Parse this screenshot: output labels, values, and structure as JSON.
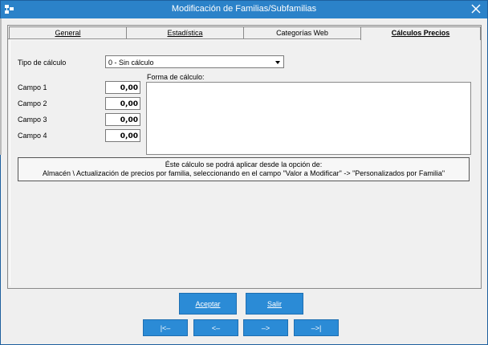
{
  "window": {
    "title": "Modificación de Familias/Subfamilias"
  },
  "tabs": [
    {
      "label": "General",
      "active": false
    },
    {
      "label": "Estadística",
      "active": false
    },
    {
      "label": "Categorías Web",
      "active": false
    },
    {
      "label": "Cálculos Precios",
      "active": true
    }
  ],
  "form": {
    "tipo_label": "Tipo de cálculo",
    "tipo_value": "0 - Sin cálculo",
    "campos": [
      {
        "label": "Campo 1",
        "value": "0,00"
      },
      {
        "label": "Campo 2",
        "value": "0,00"
      },
      {
        "label": "Campo 3",
        "value": "0,00"
      },
      {
        "label": "Campo 4",
        "value": "0,00"
      }
    ],
    "forma_label": "Forma de cálculo:",
    "note_line1": "Éste cálculo se podrá aplicar desde la opción de:",
    "note_line2": "Almacén \\ Actualización de precios por familia, seleccionando en el campo \"Valor a Modificar\" -> \"Personalizados por Familia\""
  },
  "buttons": {
    "aceptar": "Aceptar",
    "salir": "Salir",
    "first": "|<–",
    "prev": "<–",
    "next": "–>",
    "last": "–>|"
  },
  "colors": {
    "titlebar": "#2b82c9",
    "button": "#2b8bd6"
  }
}
